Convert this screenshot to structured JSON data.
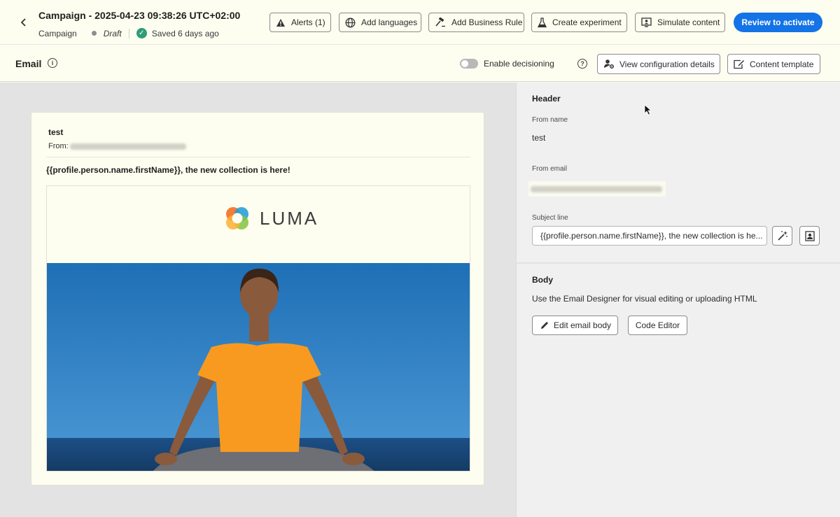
{
  "header": {
    "title": "Campaign - 2025-04-23 09:38:26 UTC+02:00",
    "type_label": "Campaign",
    "status": "Draft",
    "saved": "Saved 6 days ago",
    "back_icon": "chevron-left-icon"
  },
  "toolbar": {
    "alerts": "Alerts (1)",
    "add_languages": "Add languages",
    "add_business_rule": "Add Business Rule",
    "create_experiment": "Create experiment",
    "simulate_content": "Simulate content",
    "review_to_activate": "Review to activate"
  },
  "subbar": {
    "title": "Email",
    "decisioning_label": "Enable decisioning",
    "decisioning_enabled": false,
    "view_config": "View configuration details",
    "content_template": "Content template"
  },
  "preview": {
    "sender_name": "test",
    "from_label": "From:",
    "subject": "{{profile.person.name.firstName}}, the new collection is here!",
    "logo_text": "LUMA"
  },
  "panel": {
    "header_title": "Header",
    "from_name_label": "From name",
    "from_name_value": "test",
    "from_email_label": "From email",
    "subject_label": "Subject line",
    "subject_value": "{{profile.person.name.firstName}}, the new collection is he...",
    "body_title": "Body",
    "body_desc": "Use the Email Designer for visual editing or uploading HTML",
    "edit_body": "Edit email body",
    "code_editor": "Code Editor"
  },
  "colors": {
    "accent": "#1473e6",
    "success": "#2d9d78",
    "background": "#fdfdf0"
  }
}
